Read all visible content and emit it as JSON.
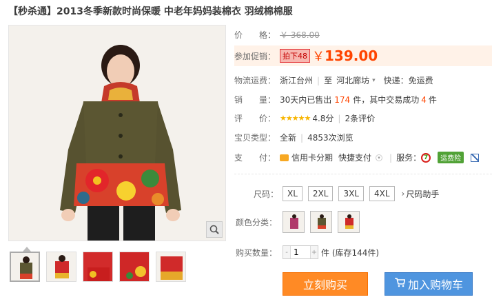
{
  "product_title": "【秒杀通】2013冬季新款时尚保暖 中老年妈妈装棉衣 羽绒棉棉服",
  "price": {
    "label": "价　　格：",
    "original": "￥ 368.00"
  },
  "promo": {
    "label": "参加促销：",
    "tag": "拍下48",
    "yen": "￥",
    "value": "139.00"
  },
  "shipping": {
    "label": "物流运费：",
    "from": "浙江台州",
    "to_prefix": "至",
    "to": "河北廊坊",
    "fee_text": "快递：免运费"
  },
  "sales": {
    "label": "销　　量：",
    "prefix": "30天内已售出",
    "sold": "174",
    "middle": "件，其中交易成功",
    "success": "4",
    "suffix": "件"
  },
  "rating": {
    "label": "评　　价：",
    "stars": "★★★★★",
    "score": "4.8分",
    "reviews": "2条评价"
  },
  "listing_type": {
    "label": "宝贝类型：",
    "value": "全新",
    "views": "4853次浏览"
  },
  "payment": {
    "label": "支　　付：",
    "card": "信用卡分期",
    "quick": "快捷支付",
    "service_label": "服务：",
    "shipping_insurance": "运费险"
  },
  "sizes": {
    "label": "尺码：",
    "options": [
      "XL",
      "2XL",
      "3XL",
      "4XL"
    ],
    "helper": "尺码助手"
  },
  "colors": {
    "label": "颜色分类："
  },
  "quantity": {
    "label": "购买数量：",
    "value": "1",
    "stock_text": "件 (库存144件)"
  },
  "actions": {
    "buy_now": "立刻购买",
    "add_to_cart": "加入购物车"
  },
  "accent_colors": {
    "price_orange": "#ff4400",
    "buy_button": "#ff8a25",
    "cart_button": "#4f95df"
  }
}
